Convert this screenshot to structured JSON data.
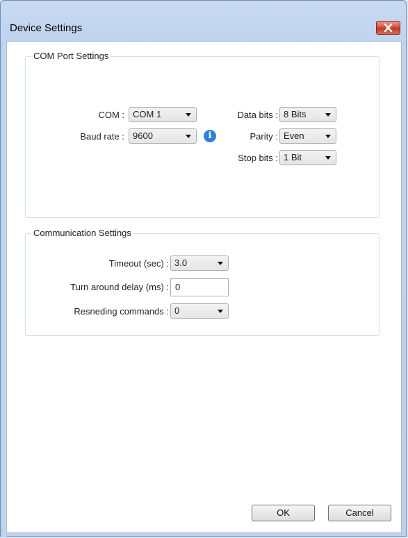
{
  "window": {
    "title": "Device Settings"
  },
  "com_port": {
    "group_title": "COM Port Settings",
    "com_label": "COM :",
    "com_value": "COM 1",
    "baud_label": "Baud rate :",
    "baud_value": "9600",
    "data_bits_label": "Data bits :",
    "data_bits_value": "8 Bits",
    "parity_label": "Parity :",
    "parity_value": "Even",
    "stop_bits_label": "Stop bits :",
    "stop_bits_value": "1 Bit"
  },
  "communication": {
    "group_title": "Communication Settings",
    "timeout_label": "Timeout (sec) :",
    "timeout_value": "3.0",
    "turnaround_label": "Turn around delay (ms) :",
    "turnaround_value": "0",
    "resending_label": "Resneding commands :",
    "resending_value": "0"
  },
  "buttons": {
    "ok": "OK",
    "cancel": "Cancel"
  },
  "icons": {
    "info": "info-icon",
    "close": "close-icon",
    "dropdown": "chevron-down-icon"
  },
  "colors": {
    "accent": "#2e83d9",
    "close_button": "#c03a25"
  }
}
